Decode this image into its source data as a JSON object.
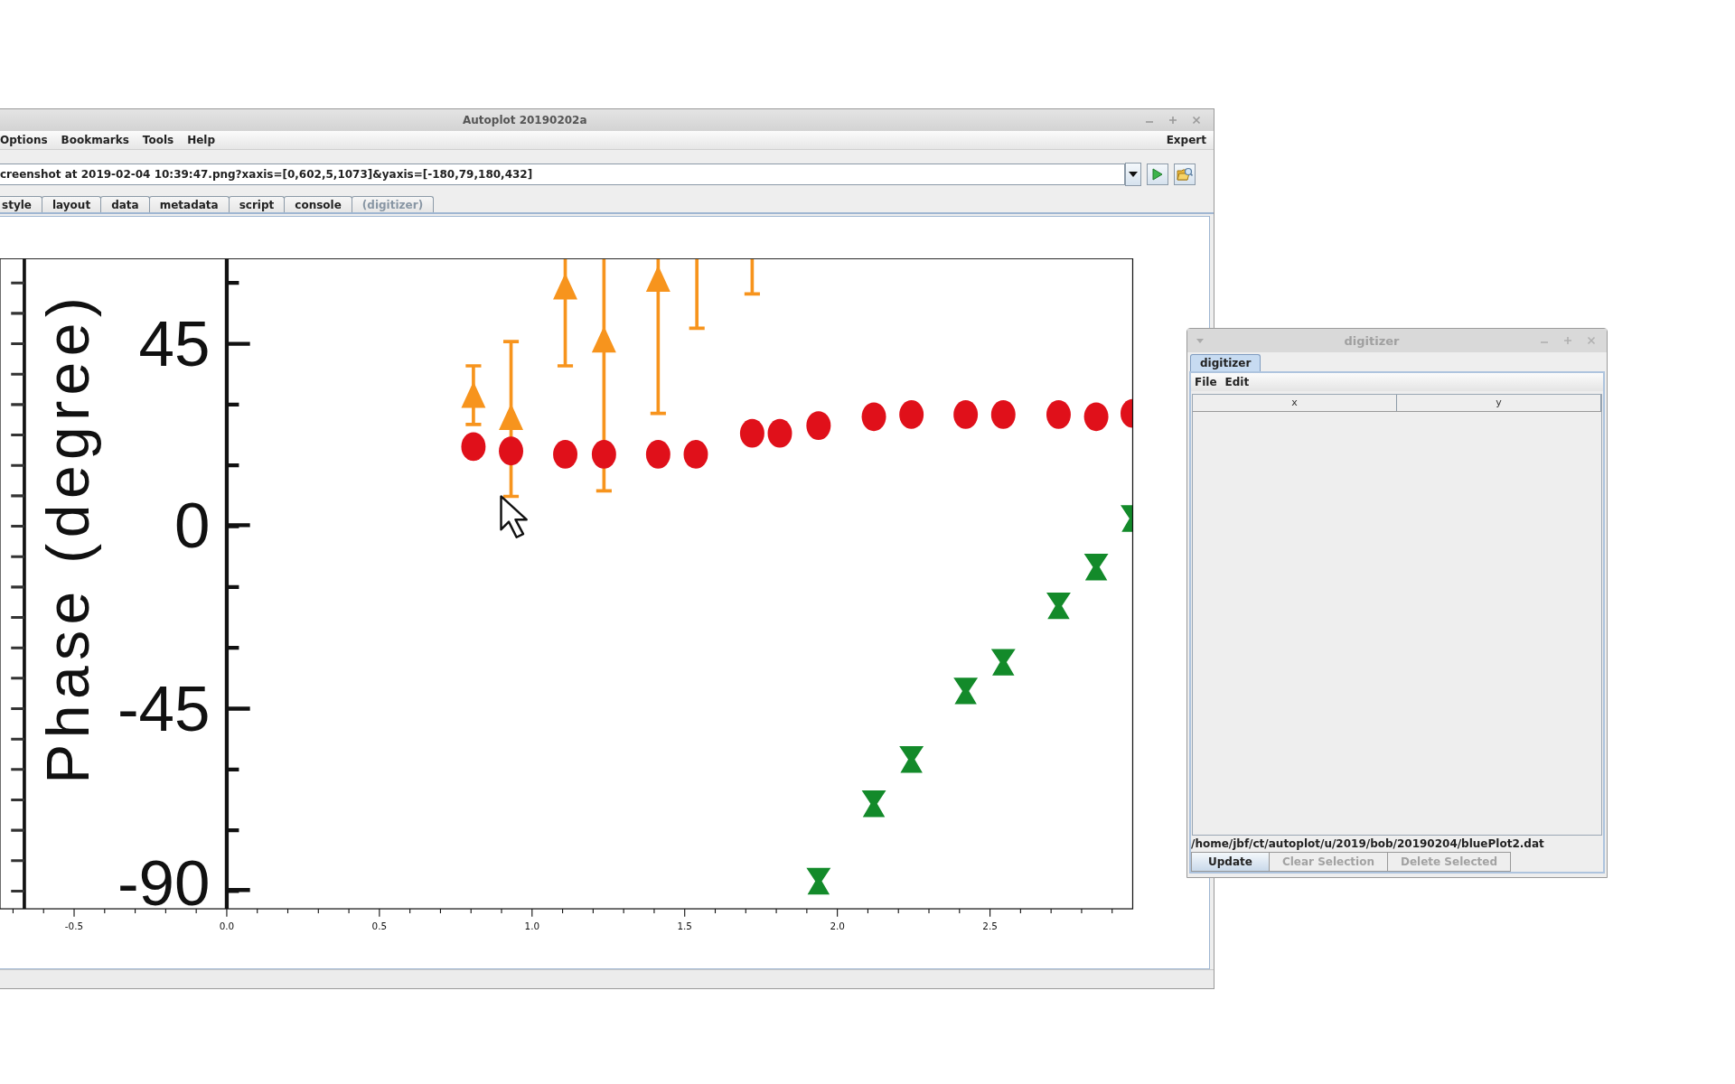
{
  "main_window": {
    "title": "Autoplot 20190202a",
    "menu": [
      "Options",
      "Bookmarks",
      "Tools",
      "Help"
    ],
    "menu_right": "Expert",
    "url": {
      "value": "creenshot at 2019-02-04 10:39:47.png?xaxis=[0,602,5,1073]&yaxis=[-180,79,180,432]"
    },
    "tabs": [
      {
        "label": "style",
        "disabled": false
      },
      {
        "label": "layout",
        "disabled": false
      },
      {
        "label": "data",
        "disabled": false
      },
      {
        "label": "metadata",
        "disabled": false
      },
      {
        "label": "script",
        "disabled": false
      },
      {
        "label": "console",
        "disabled": false
      },
      {
        "label": "(digitizer)",
        "disabled": true
      }
    ],
    "plot": {
      "image": {
        "ylabel": "Phase (degree)",
        "yticks": [
          "45",
          "0",
          "-45",
          "-90"
        ]
      },
      "xticks": [
        "-0.5",
        "0.0",
        "0.5",
        "1.0",
        "1.5",
        "2.0",
        "2.5"
      ]
    }
  },
  "digitizer_window": {
    "title": "digitizer",
    "tabs": [
      {
        "label": "digitizer",
        "selected": true
      }
    ],
    "menu": [
      "File",
      "Edit"
    ],
    "columns": [
      "x",
      "y"
    ],
    "file_path": "/home/jbf/ct/autoplot/u/2019/bob/20190204/bluePlot2.dat",
    "buttons": [
      {
        "label": "Update",
        "disabled": false
      },
      {
        "label": "Clear Selection",
        "disabled": true
      },
      {
        "label": "Delete Selected",
        "disabled": true
      }
    ]
  }
}
